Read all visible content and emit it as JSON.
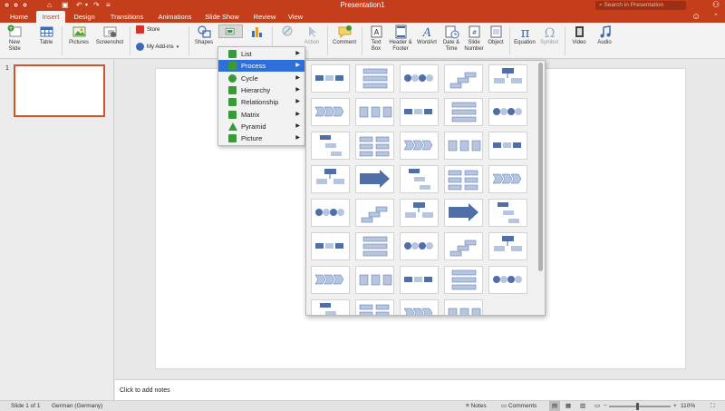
{
  "window": {
    "title": "Presentation1"
  },
  "search": {
    "placeholder": "Search in Presentation"
  },
  "tabs": [
    "Home",
    "Insert",
    "Design",
    "Transitions",
    "Animations",
    "Slide Show",
    "Review",
    "View"
  ],
  "active_tab": "Insert",
  "ribbon": {
    "new_slide": "New\nSlide",
    "table": "Table",
    "pictures": "Pictures",
    "screenshot": "Screenshot",
    "store": "Store",
    "my_addins": "My Add-ins",
    "shapes": "Shapes",
    "action": "Action",
    "comment": "Comment",
    "text_box": "Text\nBox",
    "header_footer": "Header &\nFooter",
    "wordart": "WordArt",
    "date_time": "Date &\nTime",
    "slide_number": "Slide\nNumber",
    "object": "Object",
    "equation": "Equation",
    "symbol": "Symbol",
    "video": "Video",
    "audio": "Audio"
  },
  "smartart_menu": [
    {
      "label": "List",
      "icon": "list-icon",
      "color": "#3a9a3a"
    },
    {
      "label": "Process",
      "icon": "process-icon",
      "color": "#3a9a3a"
    },
    {
      "label": "Cycle",
      "icon": "cycle-icon",
      "color": "#3a9a3a"
    },
    {
      "label": "Hierarchy",
      "icon": "hierarchy-icon",
      "color": "#3a9a3a"
    },
    {
      "label": "Relationship",
      "icon": "relationship-icon",
      "color": "#3a9a3a"
    },
    {
      "label": "Matrix",
      "icon": "matrix-icon",
      "color": "#3a9a3a"
    },
    {
      "label": "Pyramid",
      "icon": "pyramid-icon",
      "color": "#3a9a3a"
    },
    {
      "label": "Picture",
      "icon": "picture-icon",
      "color": "#3a9a3a"
    }
  ],
  "smartart_selected": "Process",
  "gallery": {
    "category": "Process",
    "layout_count": 39
  },
  "thumbnails": {
    "slide_number": "1"
  },
  "notes": {
    "placeholder": "Click to add notes"
  },
  "status": {
    "slide_info": "Slide 1 of 1",
    "language": "German (Germany)",
    "notes": "Notes",
    "comments": "Comments",
    "zoom": "110%"
  },
  "colors": {
    "accent": "#c43e1c",
    "menu_highlight": "#2f6fdc",
    "smartart_blue": "#4f6fa8"
  }
}
